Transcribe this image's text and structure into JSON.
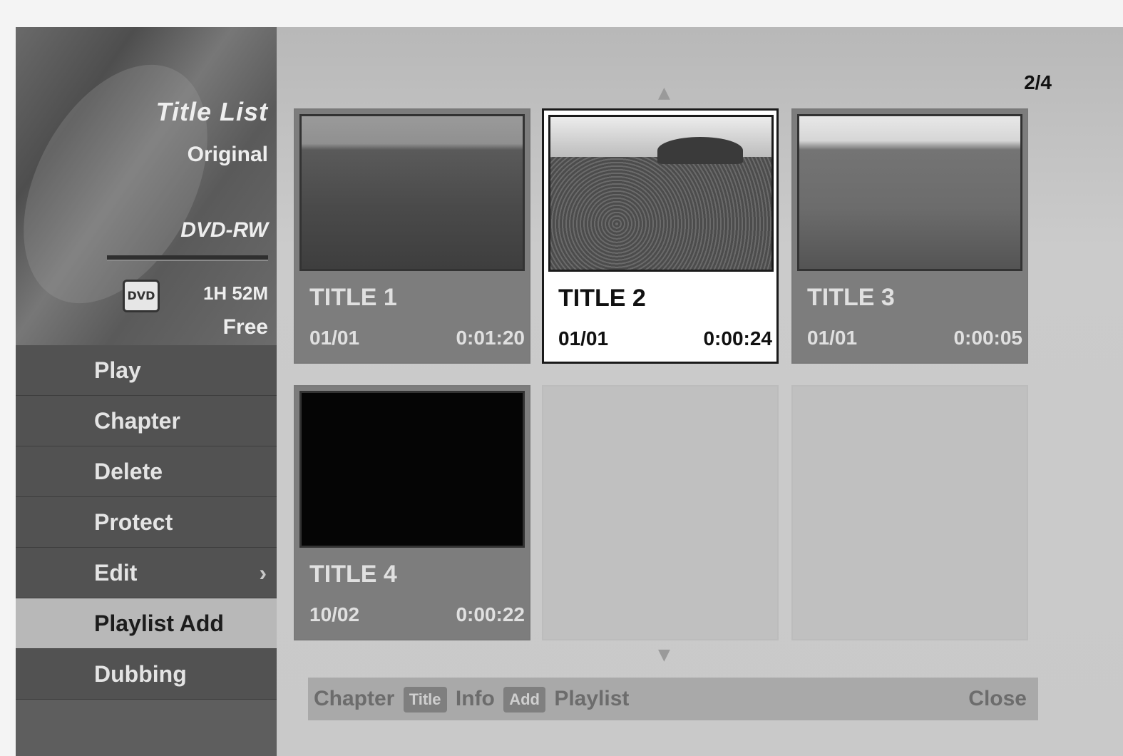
{
  "sidebar": {
    "title": "Title List",
    "subtitle": "Original",
    "disc_type": "DVD-RW",
    "disc_icon": "disc-icon",
    "disc_icon_label": "DVD",
    "free_time": "1H 52M",
    "free_label": "Free",
    "menu": [
      {
        "label": "Play",
        "selected": false
      },
      {
        "label": "Chapter",
        "selected": false
      },
      {
        "label": "Delete",
        "selected": false
      },
      {
        "label": "Protect",
        "selected": false
      },
      {
        "label": "Edit",
        "selected": false,
        "has_submenu": true
      },
      {
        "label": "Playlist Add",
        "selected": true
      },
      {
        "label": "Dubbing",
        "selected": false
      }
    ],
    "submenu_icon": "chevron-right-icon"
  },
  "content": {
    "page_indicator": "2/4",
    "titles": [
      {
        "name": "TITLE 1",
        "date": "01/01",
        "length": "0:01:20",
        "selected": false
      },
      {
        "name": "TITLE 2",
        "date": "01/01",
        "length": "0:00:24",
        "selected": true
      },
      {
        "name": "TITLE 3",
        "date": "01/01",
        "length": "0:00:05",
        "selected": false
      },
      {
        "name": "TITLE 4",
        "date": "10/02",
        "length": "0:00:22",
        "selected": false
      }
    ],
    "help": {
      "text_1": "Chapter",
      "key_1": "Title",
      "text_2": "Info",
      "key_2": "Add",
      "text_3": "Playlist",
      "close": "Close"
    }
  },
  "colors": {
    "selected_tile": "#ffffff",
    "selected_menu": "#b8b8b8",
    "panel": "#5e5e5e",
    "background": "#c4c4c4"
  }
}
